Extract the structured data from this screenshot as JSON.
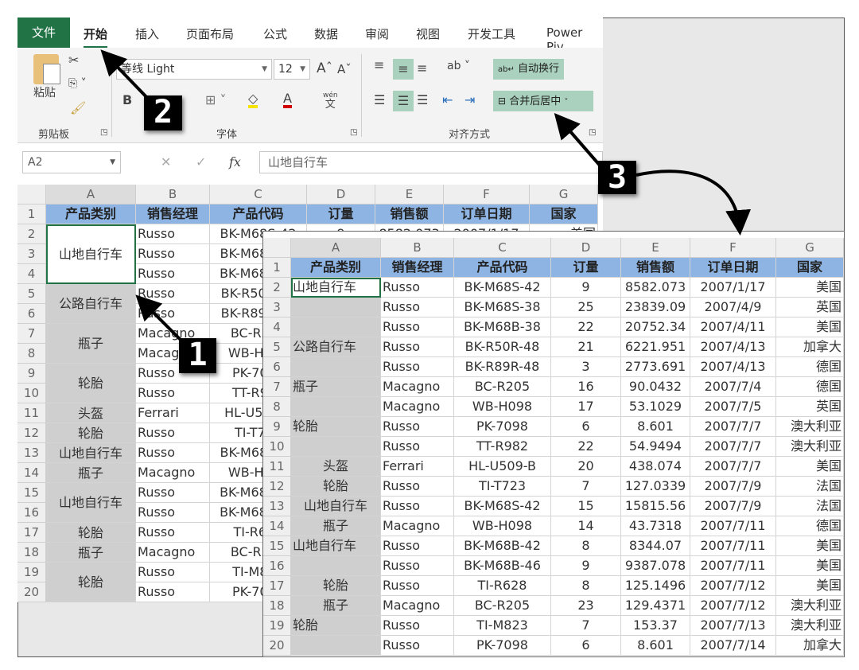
{
  "ribbon_tabs": [
    "文件",
    "开始",
    "插入",
    "页面布局",
    "公式",
    "数据",
    "审阅",
    "视图",
    "开发工具",
    "Power Piv"
  ],
  "clipboard": {
    "paste": "粘贴",
    "group": "剪贴板"
  },
  "font": {
    "name": "等线 Light",
    "size": "12",
    "bold": "B",
    "group": "字体",
    "phonetic": "wén"
  },
  "alignment": {
    "wrap_text": "自动换行",
    "merge_center": "合并后居中",
    "group": "对齐方式"
  },
  "formula_bar": {
    "name_box": "A2",
    "fx": "fx",
    "content": "山地自行车"
  },
  "columns": [
    "A",
    "B",
    "C",
    "D",
    "E",
    "F",
    "G"
  ],
  "headers": [
    "产品类别",
    "销售经理",
    "产品代码",
    "订量",
    "销售额",
    "订单日期",
    "国家"
  ],
  "rows": [
    [
      "Russo",
      "BK-M68S-42",
      "9",
      "8582.073",
      "2007/1/17",
      "美国"
    ],
    [
      "Russo",
      "BK-M68S-38",
      "25",
      "23839.09",
      "2007/4/9",
      "英国"
    ],
    [
      "Russo",
      "BK-M68B-38",
      "22",
      "20752.34",
      "2007/4/11",
      "美国"
    ],
    [
      "Russo",
      "BK-R50R-48",
      "21",
      "6221.951",
      "2007/4/13",
      "加拿大"
    ],
    [
      "Russo",
      "BK-R89R-48",
      "3",
      "2773.691",
      "2007/4/13",
      "德国"
    ],
    [
      "Macagno",
      "BC-R205",
      "16",
      "90.0432",
      "2007/7/4",
      "德国"
    ],
    [
      "Macagno",
      "WB-H098",
      "17",
      "53.1029",
      "2007/7/5",
      "英国"
    ],
    [
      "Russo",
      "PK-7098",
      "6",
      "8.601",
      "2007/7/7",
      "澳大利亚"
    ],
    [
      "Russo",
      "TT-R982",
      "22",
      "54.9494",
      "2007/7/7",
      "澳大利亚"
    ],
    [
      "Ferrari",
      "HL-U509-B",
      "20",
      "438.074",
      "2007/7/7",
      "美国"
    ],
    [
      "Russo",
      "TI-T723",
      "7",
      "127.0339",
      "2007/7/9",
      "法国"
    ],
    [
      "Russo",
      "BK-M68S-42",
      "15",
      "15815.56",
      "2007/7/9",
      "法国"
    ],
    [
      "Macagno",
      "WB-H098",
      "14",
      "43.7318",
      "2007/7/11",
      "德国"
    ],
    [
      "Russo",
      "BK-M68B-42",
      "8",
      "8344.07",
      "2007/7/11",
      "美国"
    ],
    [
      "Russo",
      "BK-M68B-46",
      "9",
      "9387.078",
      "2007/7/11",
      "美国"
    ],
    [
      "Russo",
      "TI-R628",
      "8",
      "125.1496",
      "2007/7/12",
      "美国"
    ],
    [
      "Macagno",
      "BC-R205",
      "23",
      "129.4371",
      "2007/7/12",
      "澳大利亚"
    ],
    [
      "Russo",
      "TI-M823",
      "7",
      "153.37",
      "2007/7/13",
      "澳大利亚"
    ],
    [
      "Russo",
      "PK-7098",
      "6",
      "8.601",
      "2007/7/14",
      "加拿大"
    ]
  ],
  "back_col_a_merged": [
    {
      "label": "山地自行车",
      "rows": 3
    },
    {
      "label": "公路自行车",
      "rows": 2
    },
    {
      "label": "瓶子",
      "rows": 2
    },
    {
      "label": "轮胎",
      "rows": 2
    },
    {
      "label": "头盔",
      "rows": 1
    },
    {
      "label": "轮胎",
      "rows": 1
    },
    {
      "label": "山地自行车",
      "rows": 1
    },
    {
      "label": "瓶子",
      "rows": 1
    },
    {
      "label": "山地自行车",
      "rows": 2
    },
    {
      "label": "轮胎",
      "rows": 1
    },
    {
      "label": "瓶子",
      "rows": 1
    },
    {
      "label": "轮胎",
      "rows": 2
    }
  ],
  "front_col_a": [
    {
      "label": "山地自行车",
      "align": "left"
    },
    {
      "label": "",
      "align": "left"
    },
    {
      "label": "",
      "align": "left"
    },
    {
      "label": "公路自行车",
      "align": "left"
    },
    {
      "label": "",
      "align": "left"
    },
    {
      "label": "瓶子",
      "align": "left"
    },
    {
      "label": "",
      "align": "left"
    },
    {
      "label": "轮胎",
      "align": "left"
    },
    {
      "label": "",
      "align": "left"
    },
    {
      "label": "头盔",
      "align": "center"
    },
    {
      "label": "轮胎",
      "align": "center"
    },
    {
      "label": "山地自行车",
      "align": "center"
    },
    {
      "label": "瓶子",
      "align": "center"
    },
    {
      "label": "山地自行车",
      "align": "left"
    },
    {
      "label": "",
      "align": "left"
    },
    {
      "label": "轮胎",
      "align": "center"
    },
    {
      "label": "瓶子",
      "align": "center"
    },
    {
      "label": "轮胎",
      "align": "left"
    },
    {
      "label": "",
      "align": "left"
    }
  ],
  "callouts": [
    "1",
    "2",
    "3"
  ],
  "colors": {
    "excel_green": "#217346",
    "header_blue": "#8db4e2",
    "merged_gray": "#cfcfcf",
    "ribbon_highlight": "#a9d1bd"
  }
}
